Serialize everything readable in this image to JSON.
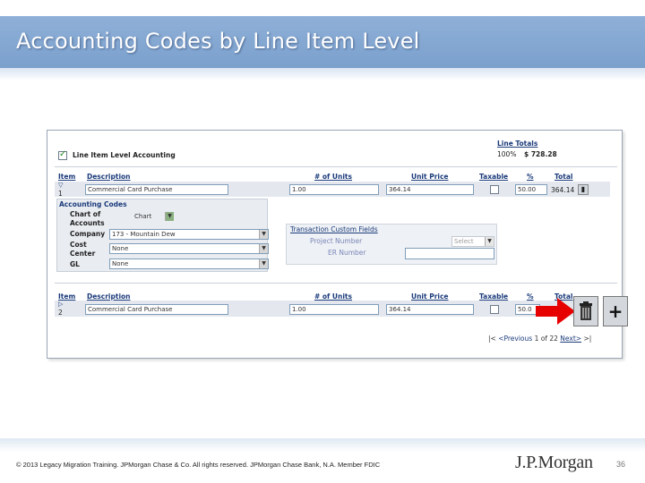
{
  "slide": {
    "title": "Accounting Codes by Line Item Level",
    "copyright": "© 2013 Legacy Migration Training. JPMorgan Chase & Co. All rights reserved. JPMorgan Chase Bank, N.A. Member FDIC",
    "logo": "J.P.Morgan",
    "page_number": "36"
  },
  "screen": {
    "line_item_level_label": "Line Item Level Accounting",
    "line_totals": {
      "label": "Line Totals",
      "percent": "100%",
      "amount": "$ 728.28"
    },
    "columns": {
      "item": "Item",
      "description": "Description",
      "units": "# of Units",
      "unit_price": "Unit Price",
      "taxable": "Taxable",
      "percent": "%",
      "total": "Total",
      "total_cut": "Total"
    },
    "line1": {
      "number": "1",
      "description": "Commercial Card Purchase",
      "units": "1.00",
      "unit_price": "364.14",
      "percent": "50.00",
      "total": "364.14"
    },
    "accounting_codes": {
      "header": "Accounting Codes",
      "chart_label_1": "Chart of",
      "chart_label_2": "Accounts",
      "chart_value": "Chart",
      "company_label": "Company",
      "company_value": "173 - Mountain Dew",
      "cost_label_1": "Cost",
      "cost_label_2": "Center",
      "cost_value": "None",
      "gl_label": "GL",
      "gl_value": "None"
    },
    "custom_fields": {
      "header": "Transaction Custom Fields",
      "project_label": "Project Number",
      "project_value": "Select",
      "er_label": "ER Number"
    },
    "line2": {
      "number": "2",
      "description": "Commercial Card Purchase",
      "units": "1.00",
      "unit_price": "364.14",
      "percent": "50.0"
    },
    "pagination": {
      "first": "|<",
      "prev": "<Previous",
      "status": "1 of 22",
      "next": "Next>",
      "last": ">|"
    },
    "icons": {
      "delete": "trash-icon",
      "add": "plus-icon",
      "callout": "red-arrow-icon"
    },
    "colors": {
      "accent": "#1a3a7a",
      "arrow": "#e60000",
      "band": "#7aa0cc"
    }
  }
}
